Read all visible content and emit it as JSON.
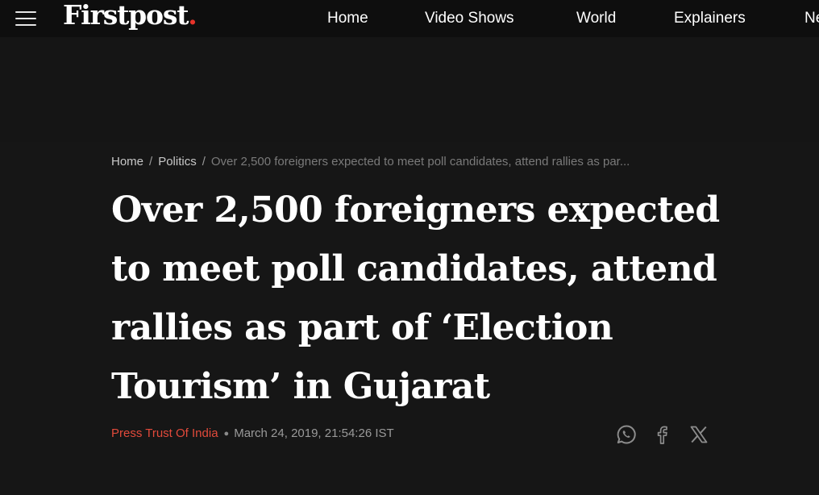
{
  "header": {
    "logo_text": "Firstpost",
    "logo_dot": ".",
    "nav": [
      {
        "label": "Home"
      },
      {
        "label": "Video Shows"
      },
      {
        "label": "World"
      },
      {
        "label": "Explainers"
      },
      {
        "label": "News"
      }
    ]
  },
  "breadcrumb": {
    "items": [
      {
        "label": "Home"
      },
      {
        "label": "Politics"
      }
    ],
    "current": "Over 2,500 foreigners expected to meet poll candidates, attend rallies as par..."
  },
  "article": {
    "title": "Over 2,500 foreigners expected to meet poll candidates, attend rallies as part of ‘Election Tourism’ in Gujarat",
    "author": "Press Trust Of India",
    "date": "March 24, 2019, 21:54:26 IST"
  },
  "share": {
    "icons": [
      "whatsapp-icon",
      "facebook-icon",
      "x-icon"
    ]
  },
  "colors": {
    "background": "#161616",
    "topbar": "#0e0e0e",
    "accent_red": "#e24a3b",
    "text": "#ffffff",
    "muted": "#9a9a9a",
    "icon": "#8c8c8c"
  }
}
